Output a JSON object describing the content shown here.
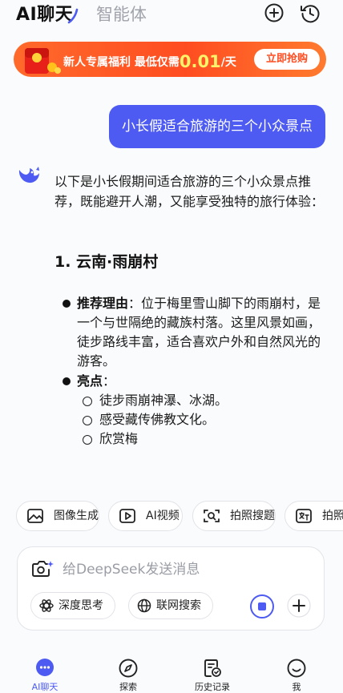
{
  "header": {
    "tab_chat": "AI聊天",
    "tab_agent": "智能体",
    "new_chat_icon": "plus-circle-icon",
    "history_icon": "history-clock-icon"
  },
  "promo": {
    "text_prefix": "新人专属福利 最低仅需",
    "price": "0.01",
    "unit": "/天",
    "button": "立即抢购"
  },
  "user_message": "小长假适合旅游的三个小众景点",
  "answer": {
    "intro": "以下是小长假期间适合旅游的三个小众景点推荐，既能避开人潮，又能享受独特的旅行体验：",
    "heading": "1. 云南·雨崩村",
    "reason_label": "推荐理由",
    "reason_text": "：位于梅里雪山脚下的雨崩村，是一个与世隔绝的藏族村落。这里风景如画，徒步路线丰富，适合喜欢户外和自然风光的游客。",
    "highlights_label": "亮点",
    "highlights_colon": "：",
    "highlights": [
      "徒步雨崩神瀑、冰湖。",
      "感受藏传佛教文化。",
      "欣赏梅"
    ]
  },
  "chips": [
    "图像生成",
    "AI视频",
    "拍照搜题",
    "拍照翻"
  ],
  "input": {
    "placeholder": "给DeepSeek发送消息",
    "deep_think": "深度思考",
    "web_search": "联网搜索"
  },
  "nav": [
    {
      "label": "AI聊天",
      "icon": "chat-bubble-icon",
      "active": true
    },
    {
      "label": "探索",
      "icon": "compass-icon",
      "active": false
    },
    {
      "label": "历史记录",
      "icon": "history-doc-icon",
      "active": false
    },
    {
      "label": "我",
      "icon": "smile-face-icon",
      "active": false
    }
  ],
  "colors": {
    "accent": "#4d5bf2",
    "promo": "#ff4d21",
    "price": "#fff36a"
  }
}
